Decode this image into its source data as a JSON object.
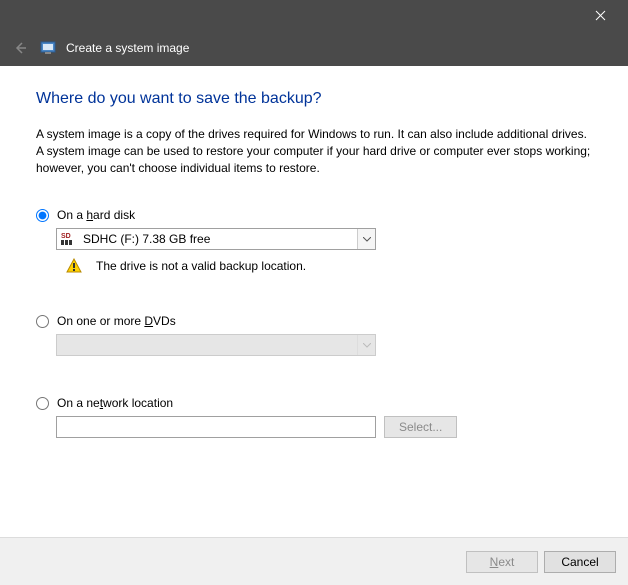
{
  "window": {
    "title": "Create a system image"
  },
  "main": {
    "heading": "Where do you want to save the backup?",
    "description": "A system image is a copy of the drives required for Windows to run. It can also include additional drives. A system image can be used to restore your computer if your hard drive or computer ever stops working; however, you can't choose individual items to restore."
  },
  "options": {
    "hard_disk": {
      "label_pre": "On a ",
      "label_u": "h",
      "label_post": "ard disk",
      "selected_drive": "SDHC (F:)  7.38 GB free",
      "warning": "The drive is not a valid backup location."
    },
    "dvd": {
      "label_pre": "On one or more ",
      "label_u": "D",
      "label_post": "VDs"
    },
    "network": {
      "label_pre": "On a ne",
      "label_u": "t",
      "label_post": "work location",
      "select_button": "Select..."
    }
  },
  "footer": {
    "next_u": "N",
    "next_post": "ext",
    "cancel": "Cancel"
  }
}
